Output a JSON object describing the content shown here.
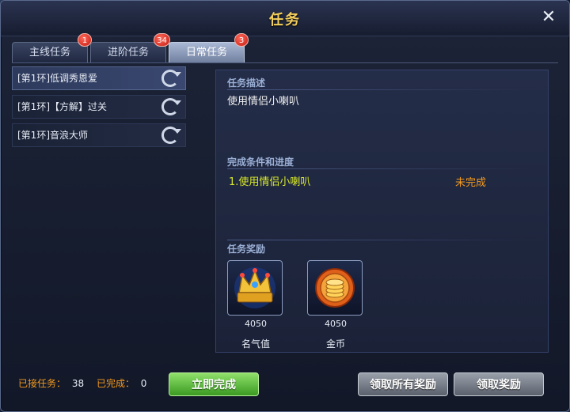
{
  "window": {
    "title": "任务",
    "close_label": "✕"
  },
  "tabs": [
    {
      "label": "主线任务",
      "badge": "1"
    },
    {
      "label": "进阶任务",
      "badge": "34"
    },
    {
      "label": "日常任务",
      "badge": "3"
    }
  ],
  "tasks": [
    {
      "label": "[第1环]低调秀恩爱"
    },
    {
      "label": "[第1环]【方解】过关"
    },
    {
      "label": "[第1环]音浪大师"
    }
  ],
  "detail": {
    "desc_title": "任务描述",
    "desc": "使用情侣小喇叭",
    "cond_title": "完成条件和进度",
    "cond": "1.使用情侣小喇叭",
    "cond_status": "未完成",
    "reward_title": "任务奖励",
    "rewards": [
      {
        "amount": "4050",
        "name": "名气值",
        "icon": "crown-icon"
      },
      {
        "amount": "4050",
        "name": "金币",
        "icon": "gold-coin-icon"
      }
    ]
  },
  "footer": {
    "accepted_label": "已接任务：",
    "accepted_value": "38",
    "completed_label": "已完成：",
    "completed_value": "0",
    "complete_now": "立即完成",
    "claim_all": "领取所有奖励",
    "claim": "领取奖励"
  },
  "colors": {
    "accent_gold": "#f4cf5c",
    "condition_yellow": "#d8e82a",
    "status_orange": "#f49a1e",
    "green_button": "#3a9a22"
  }
}
